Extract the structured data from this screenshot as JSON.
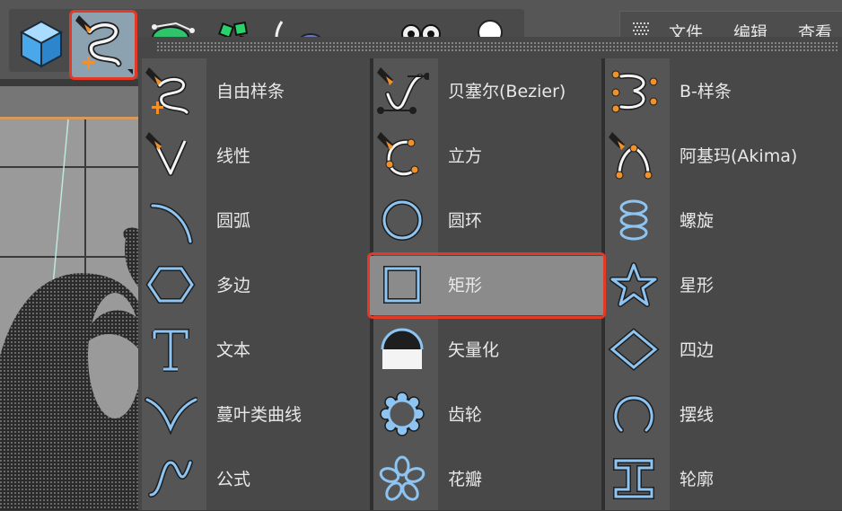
{
  "menubar": {
    "items": [
      "文件",
      "编辑",
      "查看"
    ]
  },
  "toolbar": {
    "buttons": [
      {
        "icon": "cube-icon"
      },
      {
        "icon": "spline-pen-icon",
        "selected": true
      },
      {
        "icon": "generator-icon"
      },
      {
        "icon": "array-icon"
      },
      {
        "icon": "deformer-icon"
      },
      {
        "icon": "floor-icon"
      },
      {
        "icon": "camera-icon"
      },
      {
        "icon": "light-icon"
      }
    ]
  },
  "spline_menu": {
    "columns": [
      [
        {
          "label": "自由样条",
          "icon": "freehand-spline-icon"
        },
        {
          "label": "线性",
          "icon": "linear-spline-icon"
        },
        {
          "label": "圆弧",
          "icon": "arc-icon"
        },
        {
          "label": "多边",
          "icon": "polygon-icon"
        },
        {
          "label": "文本",
          "icon": "text-icon"
        },
        {
          "label": "蔓叶类曲线",
          "icon": "cissoid-icon"
        },
        {
          "label": "公式",
          "icon": "formula-icon"
        }
      ],
      [
        {
          "label": "贝塞尔(Bezier)",
          "icon": "bezier-icon"
        },
        {
          "label": "立方",
          "icon": "cubic-icon"
        },
        {
          "label": "圆环",
          "icon": "circle-icon"
        },
        {
          "label": "矩形",
          "icon": "rectangle-icon",
          "selected": true
        },
        {
          "label": "矢量化",
          "icon": "vectorizer-icon"
        },
        {
          "label": "齿轮",
          "icon": "cogwheel-icon"
        },
        {
          "label": "花瓣",
          "icon": "flower-icon"
        }
      ],
      [
        {
          "label": "B-样条",
          "icon": "b-spline-icon"
        },
        {
          "label": "阿基玛(Akima)",
          "icon": "akima-icon"
        },
        {
          "label": "螺旋",
          "icon": "helix-icon"
        },
        {
          "label": "星形",
          "icon": "star-icon"
        },
        {
          "label": "四边",
          "icon": "four-side-icon"
        },
        {
          "label": "摆线",
          "icon": "cycloid-icon"
        },
        {
          "label": "轮廓",
          "icon": "profile-icon"
        }
      ]
    ]
  },
  "colors": {
    "highlight": "#e23a27",
    "icon_blue": "#8dc4f2",
    "pen_orange": "#f0912c",
    "selected_bg": "#8b8b8b"
  }
}
